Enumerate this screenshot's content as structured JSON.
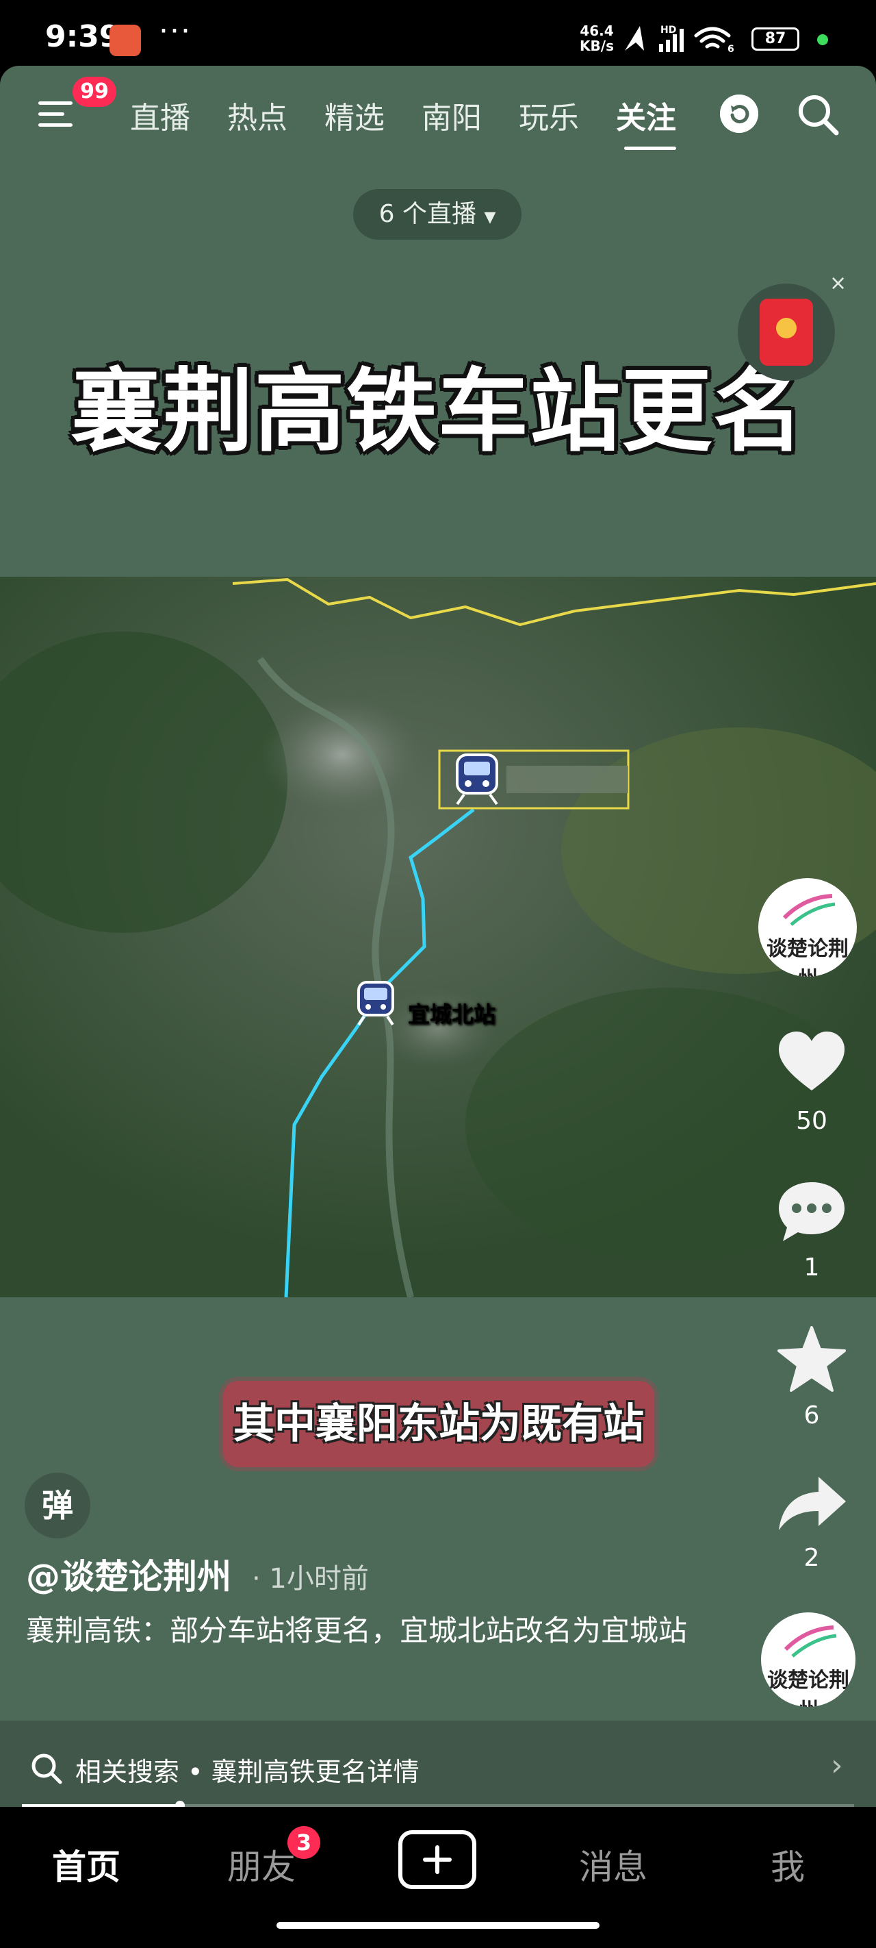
{
  "status_bar": {
    "time": "9:39",
    "more": "···",
    "net_speed_value": "46.4",
    "net_speed_unit": "KB/s",
    "signal_label": "HD",
    "wifi_label": "6",
    "battery": "87"
  },
  "nav": {
    "menu_badge": "99",
    "tabs": [
      "直播",
      "热点",
      "精选",
      "南阳",
      "玩乐",
      "关注"
    ],
    "active_tab": "关注"
  },
  "live_pill": "6 个直播",
  "video": {
    "headline": "襄荆高铁车站更名",
    "map_station_label": "宜城北站",
    "caption": "其中襄阳东站为既有站"
  },
  "right_rail": {
    "author_avatar_text": "谈楚论荆州",
    "likes": "50",
    "comments": "1",
    "favorites": "6",
    "shares": "2",
    "music_avatar_text": "谈楚论荆州"
  },
  "post": {
    "danmu": "弹",
    "author": "@谈楚论荆州",
    "time_ago": "· 1小时前",
    "description": "襄荆高铁：部分车站将更名，宜城北站改名为宜城站"
  },
  "related_search": {
    "prefix": "相关搜索",
    "query": "襄荆高铁更名详情"
  },
  "progress": {
    "fraction": 0.19
  },
  "bottom_tabs": {
    "home": "首页",
    "friends": "朋友",
    "friends_badge": "3",
    "messages": "消息",
    "me": "我"
  },
  "colors": {
    "accent_badge": "#fe2c55",
    "video_bg": "#4d6a59",
    "caption_bg": "#a3464f",
    "rail_line": "#39d3f5",
    "border_line": "#e8d94a"
  }
}
